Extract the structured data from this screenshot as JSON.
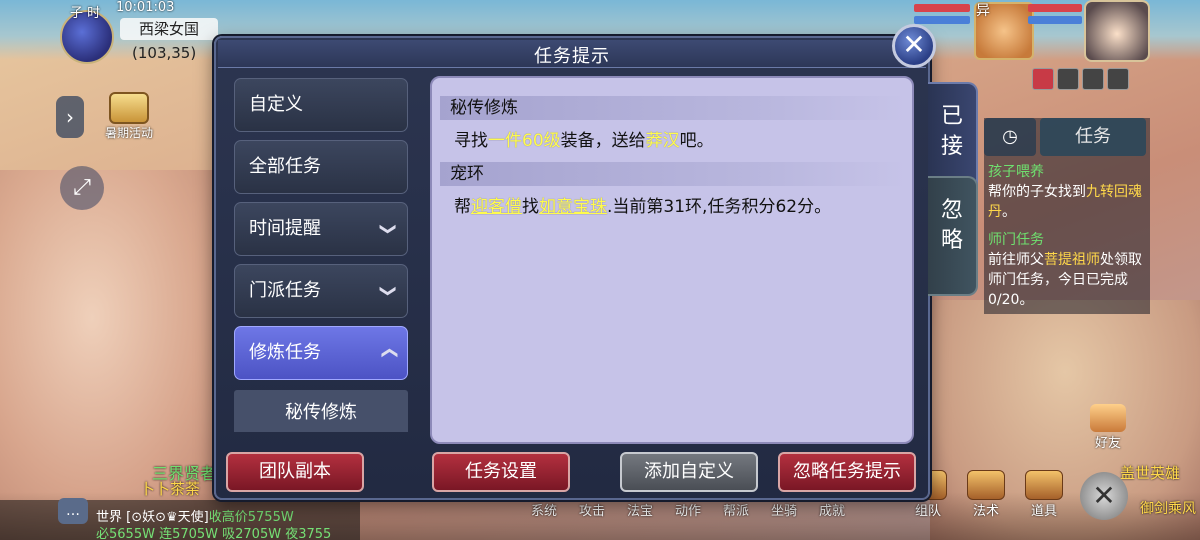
{
  "hud": {
    "time_label": "子 时",
    "clock": "10:01:03",
    "map_name": "西梁女国",
    "coords": "(103,35)",
    "activity_label": "暑期活动",
    "player_tag": "异"
  },
  "dialog": {
    "title": "任务提示",
    "categories": [
      {
        "label": "自定义"
      },
      {
        "label": "全部任务"
      },
      {
        "label": "时间提醒"
      },
      {
        "label": "门派任务"
      },
      {
        "label": "修炼任务"
      }
    ],
    "sub_item": "秘传修炼",
    "side_tabs": {
      "accepted": "已\n接",
      "ignored": "忽\n略"
    },
    "sections": [
      {
        "title": "秘传修炼",
        "parts": [
          "寻找",
          "一件60级",
          "装备，送给",
          "莽汉",
          "吧。"
        ]
      },
      {
        "title": "宠环",
        "parts": [
          "帮",
          "迎客僧",
          "找",
          "如意宝珠",
          ".当前第31环,任务积分62分。"
        ]
      }
    ],
    "buttons": {
      "team_dungeon": "团队副本",
      "quest_settings": "任务设置",
      "add_custom": "添加自定义",
      "ignore_hint": "忽略任务提示"
    }
  },
  "tracker": {
    "tab_label": "任务",
    "items": [
      {
        "title": "孩子喂养",
        "parts": [
          "帮你的子女找到",
          "九转回魂丹",
          "。"
        ]
      },
      {
        "title": "师门任务",
        "parts": [
          "前往师父",
          "菩提祖师",
          "处领取师门任务，今日已完成0/20。"
        ]
      }
    ]
  },
  "chat": {
    "world_tag": "世界",
    "line1_prefix": "[⊙妖⊙♛天使]",
    "line1_rest": "收高价5755W",
    "line2": "必5655W 连5705W 吸2705W 夜3755"
  },
  "scene": {
    "npc_name": "三界贤者",
    "npc_sub": "卜卜茶荼",
    "hero_name": "盖世英雄",
    "hero_sub": "御剑乘风"
  },
  "bottom_menu": [
    "系统",
    "攻击",
    "法宝",
    "动作",
    "帮派",
    "坐骑",
    "成就"
  ],
  "right_buttons": [
    "组队",
    "法术",
    "道具"
  ],
  "friend_label": "好友"
}
